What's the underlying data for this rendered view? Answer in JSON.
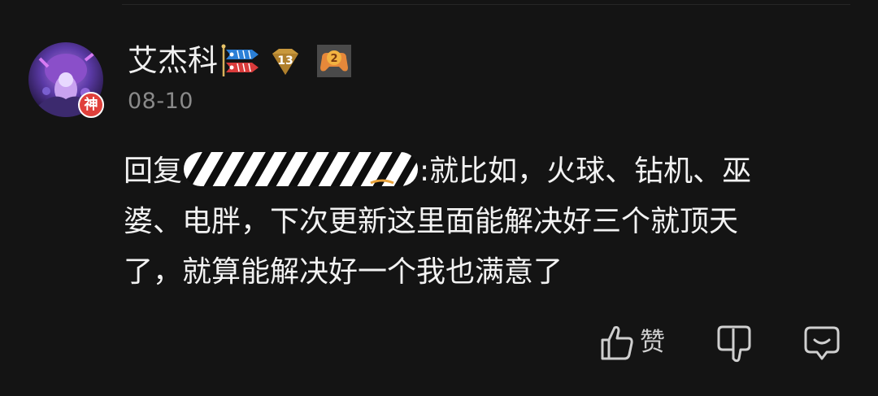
{
  "comment": {
    "username": "艾杰科",
    "avatar_badge": "神",
    "level_badge": "13",
    "gamepad_badge": "2",
    "date": "08-10",
    "reply_prefix": "回复",
    "content_lines": [
      ":就比如，火球、钻机、巫",
      "婆、电胖，下次更新这里面能解决好三个就顶天",
      "了，就算能解决好一个我也满意了"
    ],
    "actions": {
      "like_label": "赞"
    }
  },
  "colors": {
    "background": "#141414",
    "text_primary": "#f2f2f2",
    "text_secondary": "#8a8a8a",
    "badge_red": "#e0403b",
    "level_gold": "#c8983c"
  },
  "icons": {
    "like": "thumbs-up-icon",
    "dislike": "thumbs-down-icon",
    "reply": "comment-bubble-icon",
    "fish_badge": "koinobori-fish-icon",
    "gamepad_badge": "gamepad-icon"
  }
}
